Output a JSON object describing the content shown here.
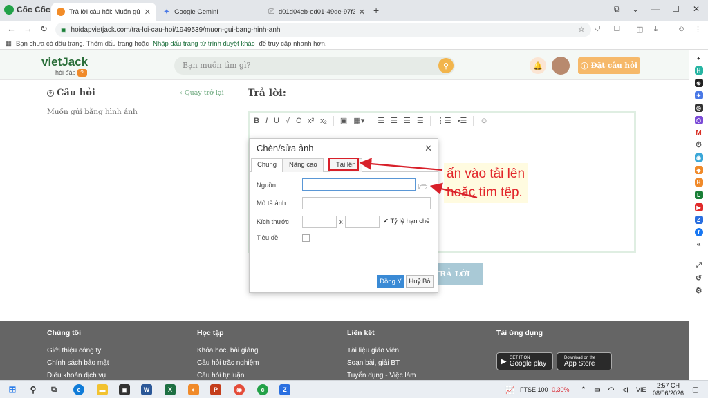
{
  "browser": {
    "brand": "Cốc Cốc",
    "tabs": [
      {
        "title": "Trả lời câu hỏi: Muốn gửi b"
      },
      {
        "title": "Google Gemini"
      },
      {
        "title": "d01d04eb-ed01-49de-97f3-d00"
      }
    ],
    "url": "hoidapvietjack.com/tra-loi-cau-hoi/1949539/muon-gui-bang-hinh-anh"
  },
  "bookmarks": {
    "text": "Bạn chưa có dấu trang. Thêm dấu trang hoặc",
    "link": "Nhập dấu trang từ trình duyệt khác",
    "suffix": "để truy cập nhanh hơn."
  },
  "site": {
    "logo": "vietJack",
    "logo_sub": "hỏi đáp",
    "logo_badge": "?",
    "search_placeholder": "Bạn muốn tìm gì?",
    "ask_button": "Đặt câu hỏi"
  },
  "question": {
    "heading": "Câu hỏi",
    "back": "Quay trở lại",
    "body": "Muốn gửi bằng hình ảnh"
  },
  "answer": {
    "heading": "Trả lời:",
    "submit": "TRẢ LỜI"
  },
  "dialog": {
    "title": "Chèn/sửa ảnh",
    "tabs": [
      "Chung",
      "Nâng cao",
      "Tải lên"
    ],
    "source_label": "Nguồn",
    "desc_label": "Mô tả ảnh",
    "size_label": "Kích thước",
    "size_x": "x",
    "constrain_label": "Tỷ lệ hạn chế",
    "title_label": "Tiêu đề",
    "ok": "Đồng Ý",
    "cancel": "Huỷ Bỏ"
  },
  "annotation": {
    "line1": "ấn vào tải lên",
    "line2": "hoặc tìm tệp."
  },
  "footer": {
    "col1_heading": "Chúng tôi",
    "col1_links": [
      "Giới thiệu công ty",
      "Chính sách bảo mật",
      "Điều khoản dịch vụ"
    ],
    "col2_heading": "Học tập",
    "col2_links": [
      "Khóa học, bài giảng",
      "Câu hỏi trắc nghiệm",
      "Câu hỏi tự luận"
    ],
    "col3_heading": "Liên kết",
    "col3_links": [
      "Tài liệu giáo viên",
      "Soạn bài, giải BT",
      "Tuyển dụng - Việc làm"
    ],
    "col4_heading": "Tải ứng dụng",
    "google_play_small": "GET IT ON",
    "google_play": "Google play",
    "app_store_small": "Download on the",
    "app_store": "App Store"
  },
  "taskbar": {
    "stock": "FTSE 100",
    "stock_change": "0,30%",
    "lang": "VIE",
    "time": "2:57 CH",
    "date": "08/06/2026"
  },
  "colors": {
    "accent_green": "#2b6f3a",
    "accent_orange": "#f08a2a",
    "annotation_red": "#e2262b",
    "dialog_ok_blue": "#3a8ad5",
    "footer_gray": "#656565"
  }
}
